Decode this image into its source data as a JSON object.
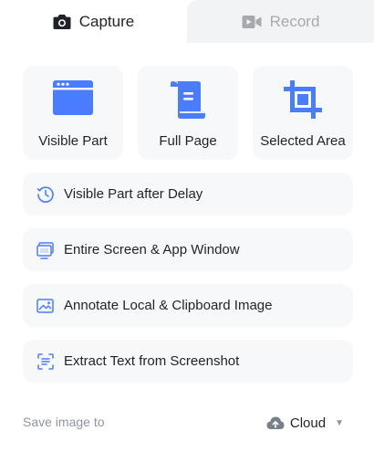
{
  "tabs": [
    {
      "label": "Capture",
      "icon": "camera-icon",
      "selected": true
    },
    {
      "label": "Record",
      "icon": "video-camera-icon",
      "selected": false
    }
  ],
  "tiles": [
    {
      "label": "Visible Part",
      "icon": "browser-window-icon"
    },
    {
      "label": "Full Page",
      "icon": "scroll-page-icon"
    },
    {
      "label": "Selected Area",
      "icon": "crop-icon"
    }
  ],
  "options": [
    {
      "label": "Visible Part after Delay",
      "icon": "timer-icon"
    },
    {
      "label": "Entire Screen & App Window",
      "icon": "monitor-icon"
    },
    {
      "label": "Annotate Local & Clipboard Image",
      "icon": "image-icon"
    },
    {
      "label": "Extract Text from Screenshot",
      "icon": "text-scan-icon"
    }
  ],
  "footer": {
    "save_label": "Save image to",
    "destination": "Cloud",
    "destination_icon": "cloud-upload-icon"
  },
  "colors": {
    "accent": "#4a7cff",
    "tile_background": "#f7f8fa",
    "inactive_tab_background": "#f2f3f5",
    "muted_text": "#8f959e"
  }
}
